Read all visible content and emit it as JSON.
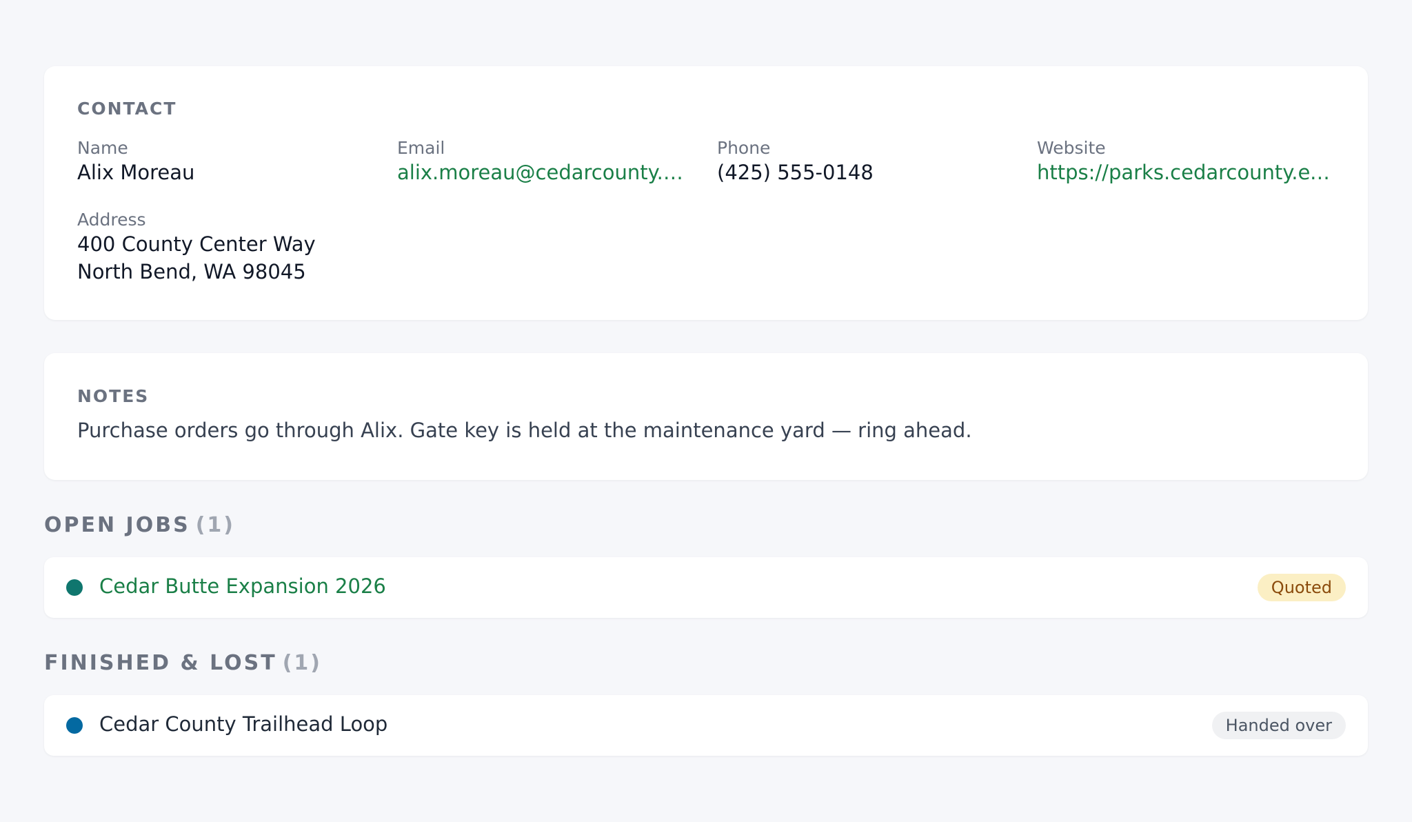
{
  "contact": {
    "heading": "CONTACT",
    "name_label": "Name",
    "name": "Alix Moreau",
    "email_label": "Email",
    "email": "alix.moreau@cedarcounty.example.gov",
    "phone_label": "Phone",
    "phone": "(425) 555-0148",
    "website_label": "Website",
    "website": "https://parks.cedarcounty.example.gov",
    "address_label": "Address",
    "address_line1": "400 County Center Way",
    "address_line2": "North Bend, WA 98045"
  },
  "notes": {
    "heading": "NOTES",
    "text": "Purchase orders go through Alix. Gate key is held at the maintenance yard — ring ahead."
  },
  "open_jobs": {
    "heading": "OPEN JOBS",
    "count": "(1)",
    "items": [
      {
        "title": "Cedar Butte Expansion 2026",
        "status": "Quoted",
        "dot_color": "#0f766e"
      }
    ]
  },
  "finished_jobs": {
    "heading": "FINISHED & LOST",
    "count": "(1)",
    "items": [
      {
        "title": "Cedar County Trailhead Loop",
        "status": "Handed over",
        "dot_color": "#0369a1"
      }
    ]
  },
  "colors": {
    "link": "#1a7f47",
    "quoted_badge_bg": "#fbefc4",
    "quoted_badge_text": "#8a4b0c",
    "handed_badge_bg": "#f0f1f3"
  }
}
